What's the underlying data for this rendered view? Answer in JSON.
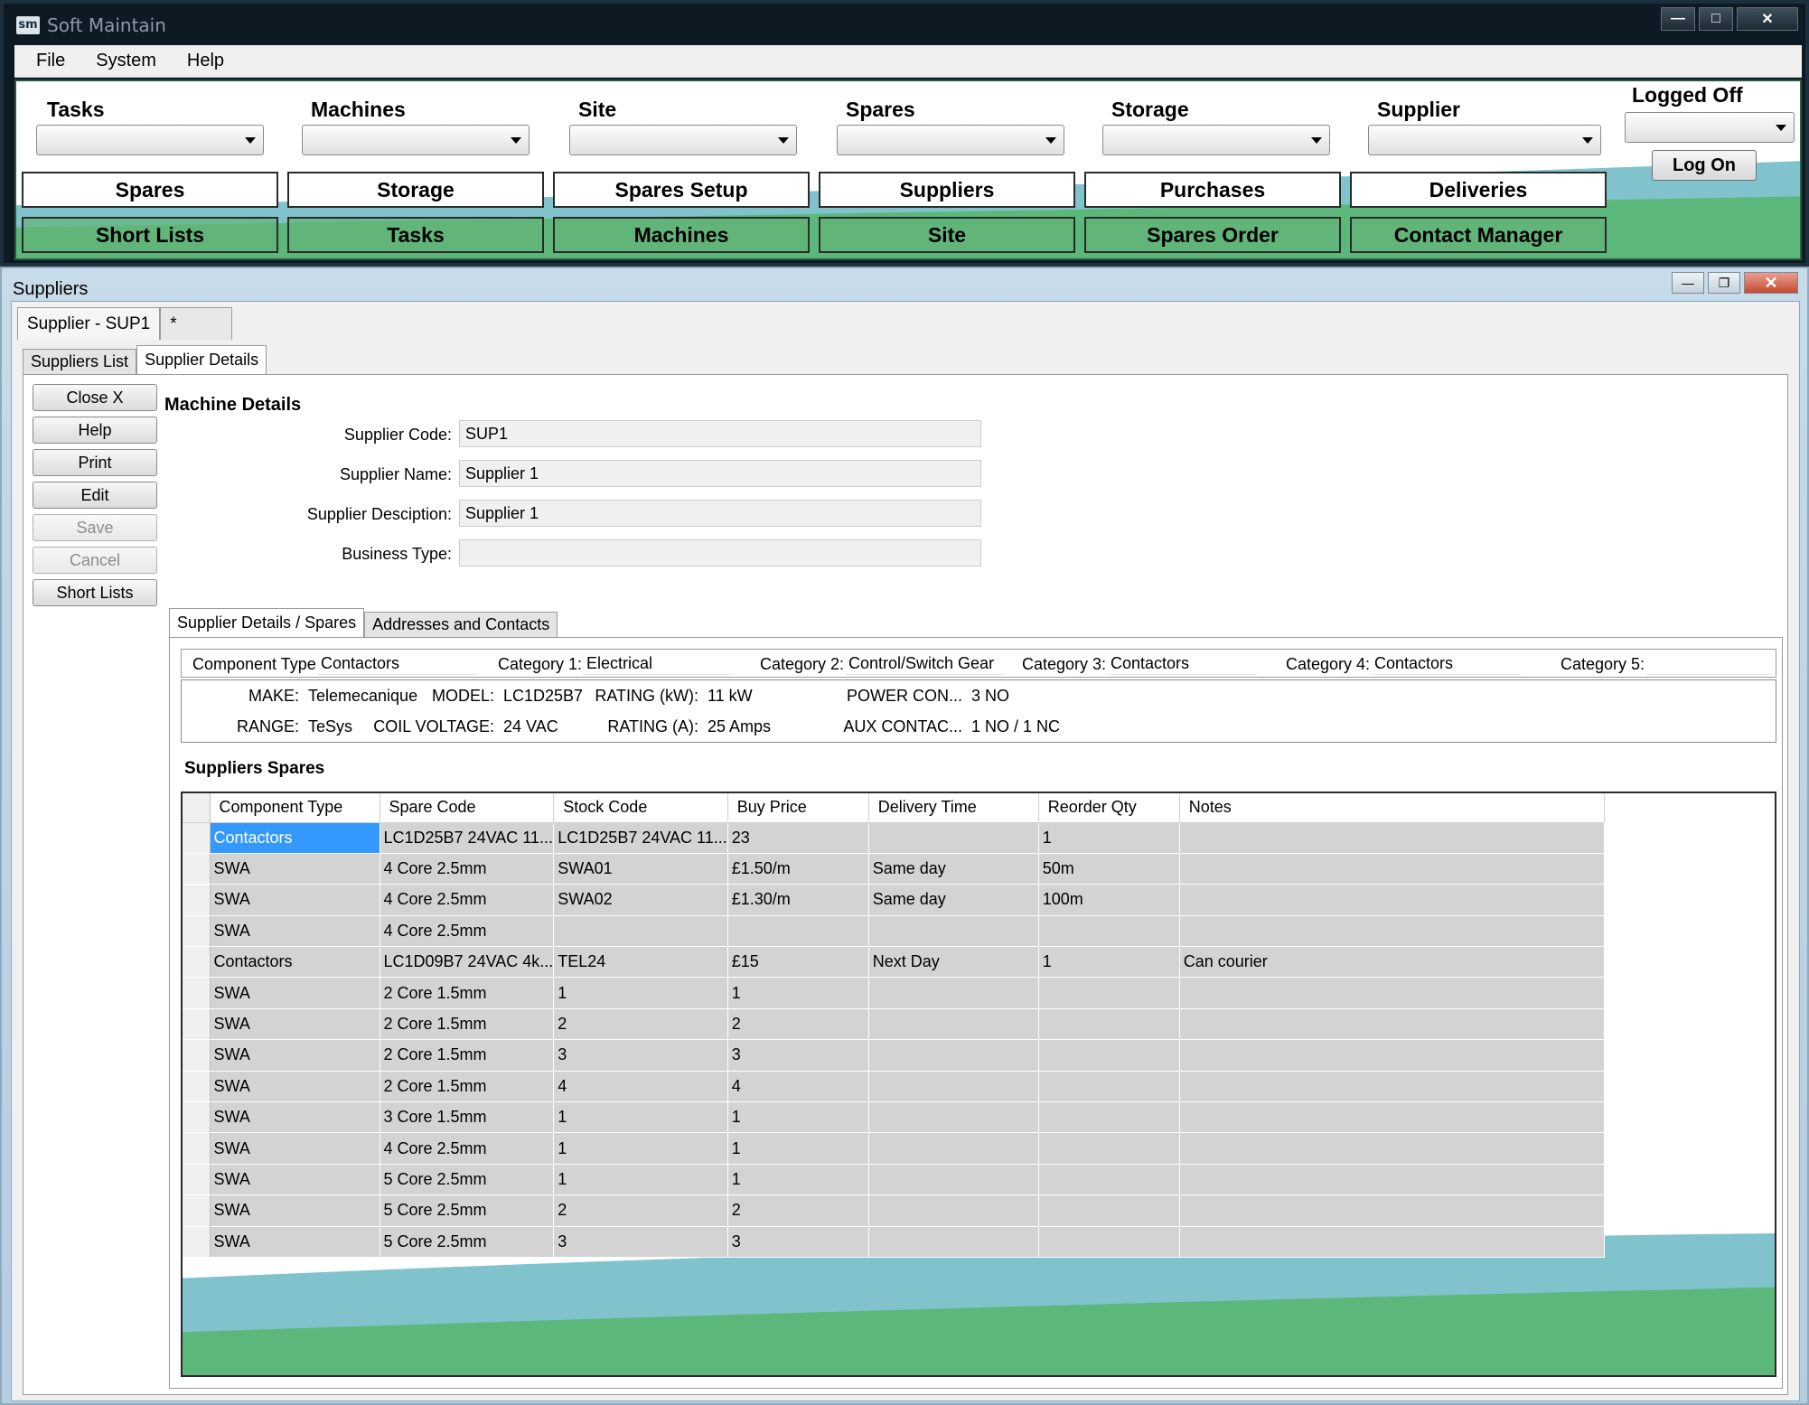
{
  "app": {
    "title": "Soft Maintain",
    "logo": "sm",
    "menu": [
      "File",
      "System",
      "Help"
    ]
  },
  "toolbar": {
    "combos": [
      "Tasks",
      "Machines",
      "Site",
      "Spares",
      "Storage",
      "Supplier"
    ],
    "login_status": "Logged Off",
    "login_button": "Log On",
    "row1": [
      "Spares",
      "Storage",
      "Spares Setup",
      "Suppliers",
      "Purchases",
      "Deliveries"
    ],
    "row2": [
      "Short Lists",
      "Tasks",
      "Machines",
      "Site",
      "Spares Order",
      "Contact Manager"
    ]
  },
  "child": {
    "title": "Suppliers",
    "doc_tab": "Supplier - SUP1",
    "doc_tab_new": "*",
    "tabs": [
      "Suppliers List",
      "Supplier Details"
    ],
    "side_buttons": [
      "Close X",
      "Help",
      "Print",
      "Edit",
      "Save",
      "Cancel",
      "Short Lists"
    ],
    "section": "Machine Details",
    "fields": [
      {
        "label": "Supplier Code:",
        "value": "SUP1"
      },
      {
        "label": "Supplier Name:",
        "value": "Supplier 1"
      },
      {
        "label": "Supplier Desciption:",
        "value": "Supplier 1"
      },
      {
        "label": "Business Type:",
        "value": ""
      }
    ],
    "subtabs": [
      "Supplier Details / Spares",
      "Addresses and Contacts"
    ],
    "categories": [
      {
        "label": "Component Type:",
        "value": "Contactors"
      },
      {
        "label": "Category 1:",
        "value": "Electrical"
      },
      {
        "label": "Category 2:",
        "value": "Control/Switch Gear"
      },
      {
        "label": "Category 3:",
        "value": "Contactors"
      },
      {
        "label": "Category 4:",
        "value": "Contactors"
      },
      {
        "label": "Category 5:",
        "value": ""
      }
    ],
    "specs": [
      {
        "label": "MAKE:",
        "value": "Telemecanique"
      },
      {
        "label": "MODEL:",
        "value": "LC1D25B7"
      },
      {
        "label": "RATING (kW):",
        "value": "11 kW"
      },
      {
        "label": "POWER CON...",
        "value": "3 NO"
      },
      {
        "label": "RANGE:",
        "value": "TeSys"
      },
      {
        "label": "COIL VOLTAGE:",
        "value": "24 VAC"
      },
      {
        "label": "RATING (A):",
        "value": "25 Amps"
      },
      {
        "label": "AUX CONTAC...",
        "value": "1 NO / 1 NC"
      }
    ],
    "spares_title": "Suppliers Spares",
    "grid": {
      "columns": [
        "Component Type",
        "Spare Code",
        "Stock Code",
        "Buy Price",
        "Delivery Time",
        "Reorder Qty",
        "Notes"
      ],
      "rows": [
        [
          "Contactors",
          "LC1D25B7 24VAC 11...",
          "LC1D25B7 24VAC 11...",
          "23",
          "",
          "1",
          ""
        ],
        [
          "SWA",
          "4 Core 2.5mm",
          "SWA01",
          "£1.50/m",
          "Same day",
          "50m",
          ""
        ],
        [
          "SWA",
          "4 Core 2.5mm",
          "SWA02",
          "£1.30/m",
          "Same day",
          "100m",
          ""
        ],
        [
          "SWA",
          "4 Core 2.5mm",
          "",
          "",
          "",
          "",
          ""
        ],
        [
          "Contactors",
          "LC1D09B7 24VAC 4k...",
          "TEL24",
          "£15",
          "Next Day",
          "1",
          "Can courier"
        ],
        [
          "SWA",
          "2 Core 1.5mm",
          "1",
          "1",
          "",
          "",
          ""
        ],
        [
          "SWA",
          "2 Core 1.5mm",
          "2",
          "2",
          "",
          "",
          ""
        ],
        [
          "SWA",
          "2 Core 1.5mm",
          "3",
          "3",
          "",
          "",
          ""
        ],
        [
          "SWA",
          "2 Core 1.5mm",
          "4",
          "4",
          "",
          "",
          ""
        ],
        [
          "SWA",
          "3 Core 1.5mm",
          "1",
          "1",
          "",
          "",
          ""
        ],
        [
          "SWA",
          "4 Core 2.5mm",
          "1",
          "1",
          "",
          "",
          ""
        ],
        [
          "SWA",
          "5 Core 2.5mm",
          "1",
          "1",
          "",
          "",
          ""
        ],
        [
          "SWA",
          "5 Core 2.5mm",
          "2",
          "2",
          "",
          "",
          ""
        ],
        [
          "SWA",
          "5 Core 2.5mm",
          "3",
          "3",
          "",
          "",
          ""
        ]
      ],
      "selected_row": 0
    }
  },
  "colors": {
    "accent_green": "#5cb87a",
    "accent_teal": "#80c3cc",
    "selection": "#3399ff"
  }
}
